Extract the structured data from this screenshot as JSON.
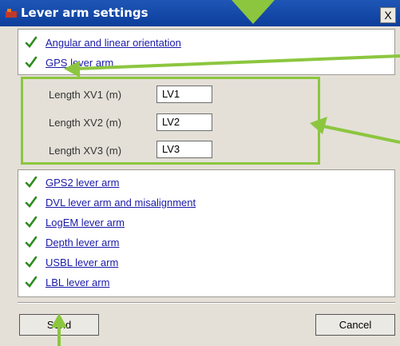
{
  "window": {
    "title": "Lever arm settings",
    "close_label": "X"
  },
  "links_top": [
    {
      "label": "Angular and linear orientation"
    },
    {
      "label": "GPS lever arm"
    }
  ],
  "fields": [
    {
      "label": "Length XV1 (m)",
      "value": "LV1"
    },
    {
      "label": "Length XV2 (m)",
      "value": "LV2"
    },
    {
      "label": "Length XV3 (m)",
      "value": "LV3"
    }
  ],
  "links_bottom": [
    {
      "label": "GPS2 lever arm"
    },
    {
      "label": "DVL lever arm and misalignment"
    },
    {
      "label": "LogEM lever arm"
    },
    {
      "label": "Depth lever arm"
    },
    {
      "label": "USBL lever arm"
    },
    {
      "label": "LBL lever arm"
    }
  ],
  "buttons": {
    "send": "Send",
    "cancel": "Cancel"
  },
  "colors": {
    "check": "#2e8b1f",
    "annotation": "#8cc63f",
    "titlebar": "#0c3e9b"
  }
}
